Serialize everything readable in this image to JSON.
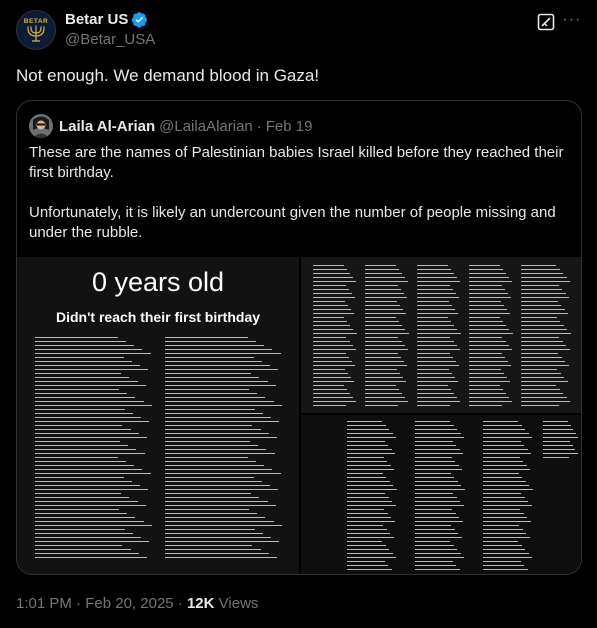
{
  "author": {
    "avatar_text": "BETAR",
    "display_name": "Betar US",
    "verified_icon": "verified-badge-icon",
    "handle": "@Betar_USA"
  },
  "post": {
    "text": "Not enough. We demand blood in Gaza!"
  },
  "quoted": {
    "display_name": "Laila Al-Arian",
    "handle": "@LailaAlarian",
    "separator": "·",
    "date": "Feb 19",
    "text_paragraphs": [
      "These are the names of Palestinian babies Israel killed before they reached their first birthday.",
      "Unfortunately, it is likely an undercount given the number of people missing and under the rubble."
    ],
    "media": {
      "title": "0 years old",
      "subtitle": "Didn't reach their first birthday"
    }
  },
  "meta": {
    "time": "1:01 PM",
    "separator": "·",
    "date": "Feb 20, 2025",
    "views_count": "12K",
    "views_label": "Views"
  },
  "colors": {
    "background": "#000000",
    "text": "#e7e9ea",
    "muted": "#71767b",
    "border": "#2f3336",
    "verified": "#1d9bf0"
  }
}
